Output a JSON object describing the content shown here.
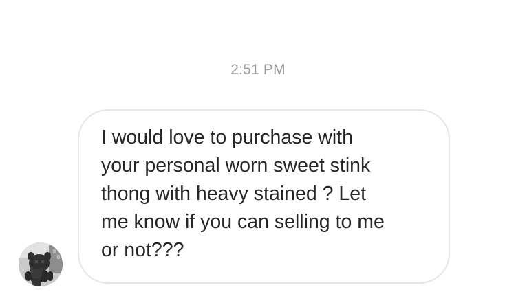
{
  "conversation": {
    "timestamp": "2:51 PM",
    "message": {
      "text": "I would love to purchase with\nyour personal worn sweet stink\nthong with heavy stained ? Let\nme know if you can selling to me\nor not???",
      "sender_avatar": "figure-sculpture-avatar"
    }
  },
  "colors": {
    "background": "#ffffff",
    "timestamp": "#9a9a9a",
    "bubble_border": "#e6e6e6",
    "text": "#262626"
  }
}
